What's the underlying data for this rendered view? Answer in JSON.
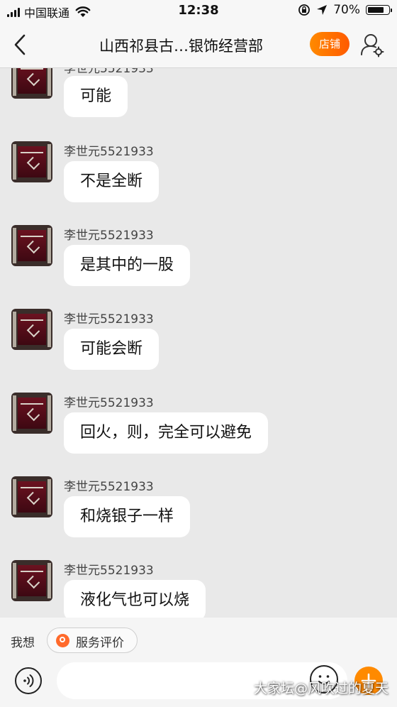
{
  "status_bar": {
    "carrier": "中国联通",
    "time": "12:38",
    "battery": "70%"
  },
  "nav": {
    "title": "山西祁县古…银饰经营部",
    "shop_label": "店铺",
    "back_icon": "chevron-left-icon",
    "user_settings_icon": "user-settings-icon"
  },
  "messages": [
    {
      "sender": "李世元5521933",
      "text": "可能"
    },
    {
      "sender": "李世元5521933",
      "text": "不是全断"
    },
    {
      "sender": "李世元5521933",
      "text": "是其中的一股"
    },
    {
      "sender": "李世元5521933",
      "text": "可能会断"
    },
    {
      "sender": "李世元5521933",
      "text": "回火，则，完全可以避免"
    },
    {
      "sender": "李世元5521933",
      "text": "和烧银子一样"
    },
    {
      "sender": "李世元5521933",
      "text": "液化气也可以烧"
    }
  ],
  "quick_bar": {
    "wo_xiang": "我想",
    "review_label": "服务评价"
  },
  "input": {
    "placeholder": "",
    "voice_icon": "voice-icon",
    "emoji_icon": "emoji-icon",
    "plus_icon": "plus-icon"
  },
  "watermark": "大家坛@风吹过的夏天",
  "colors": {
    "accent": "#ff6a00",
    "bubble": "#ffffff",
    "background": "#e9e9e9"
  }
}
